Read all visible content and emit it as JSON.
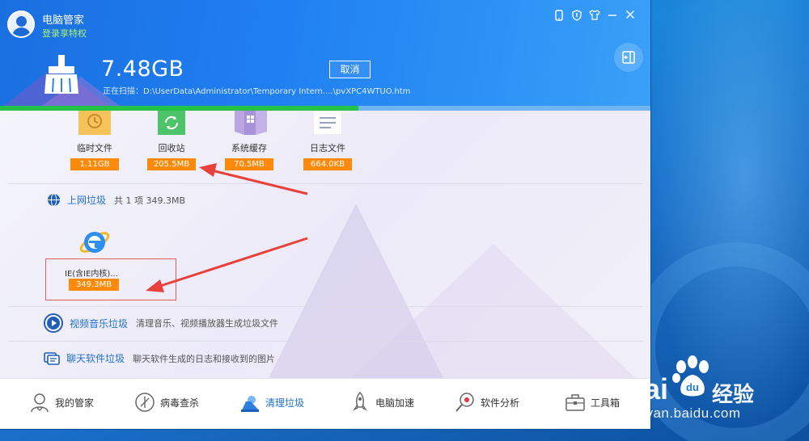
{
  "header": {
    "app_title": "电脑管家",
    "login_link": "登录享特权",
    "scanned_size": "7.48GB",
    "scan_path": "正在扫描：D:\\UserData\\Administrator\\Temporary Intern....\\pvXPC4WTUO.htm",
    "cancel_label": "取消",
    "progress_fraction": 0.55
  },
  "system_items": [
    {
      "label": "临时文件",
      "size": "1.11GB",
      "icon": "clock-folder-icon"
    },
    {
      "label": "回收站",
      "size": "205.5MB",
      "icon": "recycle-icon"
    },
    {
      "label": "系统缓存",
      "size": "70.5MB",
      "icon": "windows-cache-icon"
    },
    {
      "label": "日志文件",
      "size": "664.0KB",
      "icon": "log-file-icon"
    }
  ],
  "web_junk": {
    "title": "上网垃圾",
    "meta": "共 1 项 349.3MB",
    "item_label": "IE(含IE内核)...",
    "item_size": "349.3MB"
  },
  "video_junk": {
    "title": "视频音乐垃圾",
    "desc": "清理音乐、视频播放器生成垃圾文件"
  },
  "chat_junk": {
    "title": "聊天软件垃圾",
    "desc": "聊天软件生成的日志和接收到的图片"
  },
  "tabs": [
    {
      "label": "我的管家",
      "icon": "butler-icon"
    },
    {
      "label": "病毒查杀",
      "icon": "antivirus-icon"
    },
    {
      "label": "清理垃圾",
      "icon": "cleanup-icon"
    },
    {
      "label": "电脑加速",
      "icon": "rocket-icon"
    },
    {
      "label": "软件分析",
      "icon": "analysis-icon"
    },
    {
      "label": "工具箱",
      "icon": "toolbox-icon"
    }
  ],
  "watermark": {
    "brand": "Bai",
    "brand2": "du",
    "cn": "经验",
    "url": "jingyan.baidu.com"
  },
  "colors": {
    "accent": "#1f6fd0",
    "size_badge": "#ff8a0a",
    "login": "#a9f27c",
    "progress": "#25c24a"
  }
}
